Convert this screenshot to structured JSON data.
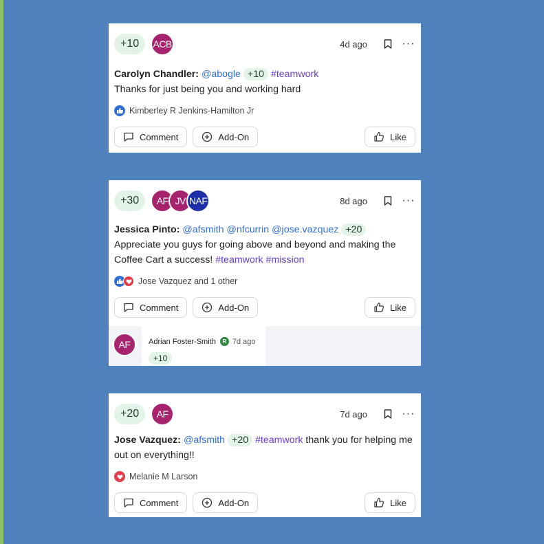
{
  "colors": {
    "background": "#4f81bd",
    "accent_green_bg": "#e3f3e7",
    "mention": "#2f6fd6",
    "hashtag": "#6a3fc8",
    "avatar_magenta": "#a8236e",
    "avatar_navy": "#1d2fa8"
  },
  "buttons": {
    "comment": "Comment",
    "addon": "Add-On",
    "like": "Like"
  },
  "posts": [
    {
      "points": "+10",
      "avatars": [
        "ACB"
      ],
      "time": "4d ago",
      "author": "Carolyn Chandler:",
      "mentions": [
        "@abogle"
      ],
      "inline_points": "+10",
      "hashtag": "#teamwork",
      "message": "Thanks for just being you and working hard",
      "reactions": "Kimberley R Jenkins-Hamilton Jr",
      "reaction_icons": [
        "thumbs-up-icon"
      ]
    },
    {
      "points": "+30",
      "avatars": [
        "AF",
        "JV",
        "NAF"
      ],
      "time": "8d ago",
      "author": "Jessica Pinto:",
      "mentions": [
        "@afsmith",
        "@nfcurrin",
        "@jose.vazquez"
      ],
      "inline_points": "+20",
      "message": "Appreciate you guys for going above and beyond and making the Coffee Cart a success!",
      "hashtags": [
        "#teamwork",
        "#mission"
      ],
      "reactions": "Jose Vazquez and 1 other",
      "reaction_icons": [
        "thumbs-up-icon",
        "heart-icon"
      ],
      "comment": {
        "avatar": "AF",
        "name": "Adrian Foster-Smith",
        "badge": "R",
        "time": "7d ago",
        "points": "+10"
      }
    },
    {
      "points": "+20",
      "avatars": [
        "AF"
      ],
      "time": "7d ago",
      "author": "Jose Vazquez:",
      "mentions": [
        "@afsmith"
      ],
      "inline_points": "+20",
      "hashtag": "#teamwork",
      "message": "thank you for helping me out on everything!!",
      "reactions": "Melanie M Larson",
      "reaction_icons": [
        "heart-icon"
      ]
    }
  ]
}
